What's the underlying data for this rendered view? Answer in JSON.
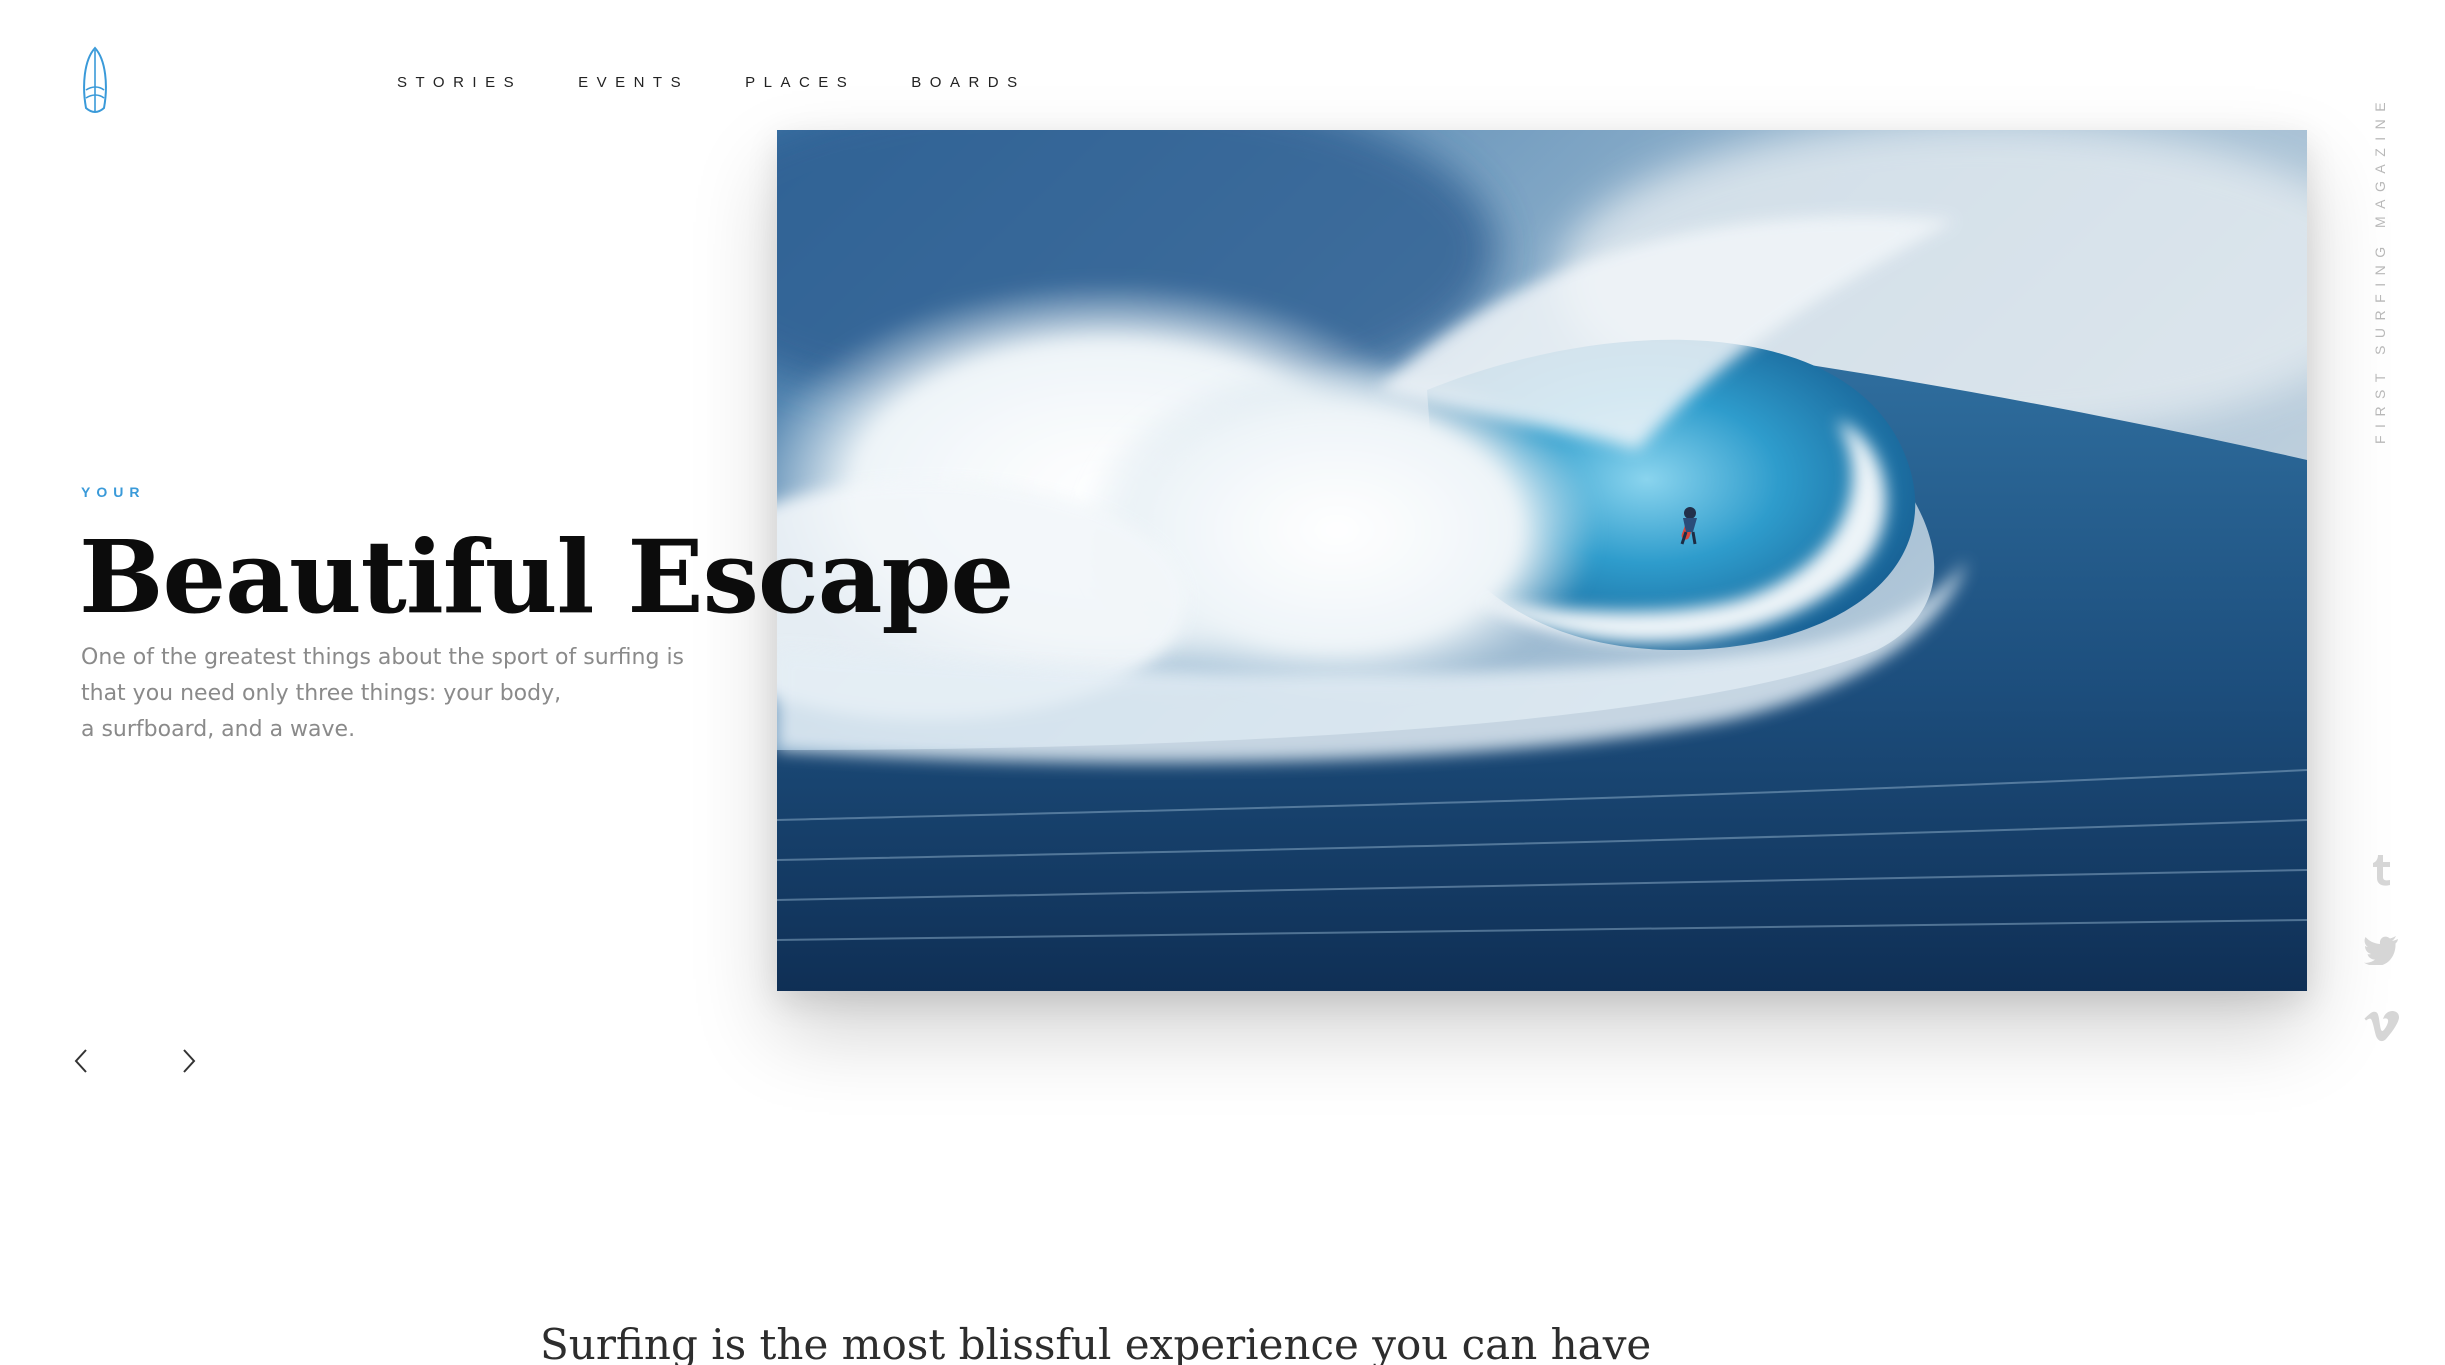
{
  "brand": {
    "logo_icon": "surfboard-icon",
    "accent_color": "#3a9ad9"
  },
  "nav": {
    "items": [
      {
        "label": "STORIES"
      },
      {
        "label": "EVENTS"
      },
      {
        "label": "PLACES"
      },
      {
        "label": "BOARDS"
      }
    ]
  },
  "hero": {
    "eyebrow": "YOUR",
    "title": "Beautiful Escape",
    "lead_lines": [
      "One of the greatest things about the sport of surfing is",
      "that you need only three things: your body,",
      "a surfboard, and a wave."
    ],
    "image_icon": "wave-surfer-photo"
  },
  "slider": {
    "prev_icon": "chevron-left-icon",
    "next_icon": "chevron-right-icon"
  },
  "side": {
    "tagline": "FIRST SURFING MAGAZINE",
    "social": [
      {
        "icon": "tumblr-icon"
      },
      {
        "icon": "twitter-icon"
      },
      {
        "icon": "vimeo-icon"
      }
    ]
  },
  "intro": {
    "quote": "Surfing is the most blissful experience you can have"
  }
}
